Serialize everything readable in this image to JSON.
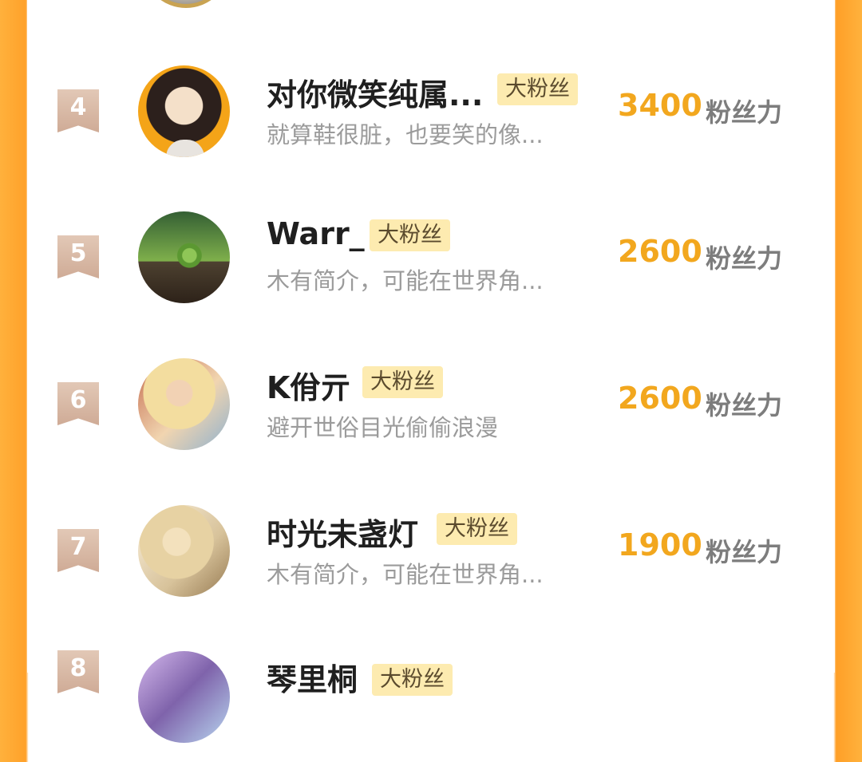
{
  "fans": [
    {
      "rank": "4",
      "name": "对你微笑纯属...",
      "badge": "大粉丝",
      "bio": "就算鞋很脏，也要笑的像...",
      "score": "3400",
      "score_label": "粉丝力"
    },
    {
      "rank": "5",
      "name": "Warr_",
      "badge": "大粉丝",
      "bio": "木有简介，可能在世界角...",
      "score": "2600",
      "score_label": "粉丝力"
    },
    {
      "rank": "6",
      "name": "K佾亓",
      "badge": "大粉丝",
      "bio": "避开世俗目光偷偷浪漫",
      "score": "2600",
      "score_label": "粉丝力"
    },
    {
      "rank": "7",
      "name": "时光未盏灯",
      "badge": "大粉丝",
      "bio": "木有简介，可能在世界角...",
      "score": "1900",
      "score_label": "粉丝力"
    },
    {
      "rank": "8",
      "name": "琴里桐",
      "badge": "大粉丝"
    }
  ],
  "colors": {
    "accent": "#f2a71e",
    "badge_bg": "#fdebb0",
    "rank_ribbon": "#d9b8a3",
    "frame": "#ffa12a"
  }
}
